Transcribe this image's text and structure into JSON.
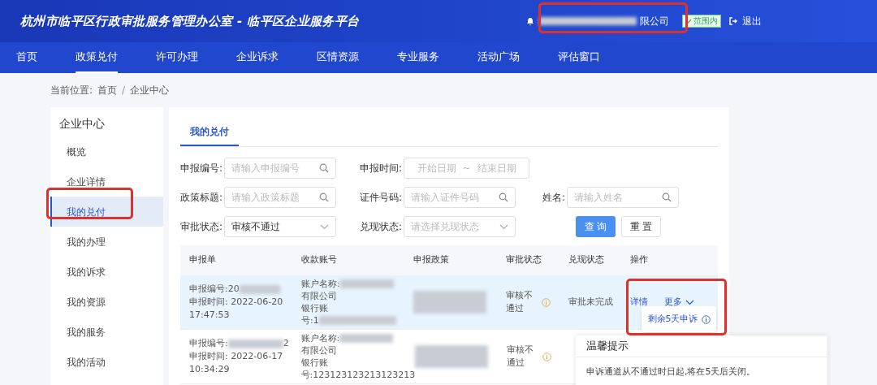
{
  "header": {
    "title": "杭州市临平区行政审批服务管理办公室 - 临平区企业服务平台",
    "company": "限公司",
    "scope_badge": "范围内",
    "logout": "退出"
  },
  "nav": [
    {
      "label": "首页",
      "selected": false
    },
    {
      "label": "政策兑付",
      "selected": true
    },
    {
      "label": "许可办理",
      "selected": false
    },
    {
      "label": "企业诉求",
      "selected": false
    },
    {
      "label": "区情资源",
      "selected": false
    },
    {
      "label": "专业服务",
      "selected": false
    },
    {
      "label": "活动广场",
      "selected": false
    },
    {
      "label": "评估窗口",
      "selected": false
    }
  ],
  "breadcrumb": {
    "label": "当前位置:",
    "separator": "/",
    "items": [
      "首页",
      "企业中心"
    ]
  },
  "sidebar": {
    "title": "企业中心",
    "items": [
      {
        "label": "概览",
        "selected": false
      },
      {
        "label": "企业详情",
        "selected": false
      },
      {
        "label": "我的兑付",
        "selected": true
      },
      {
        "label": "我的办理",
        "selected": false
      },
      {
        "label": "我的诉求",
        "selected": false
      },
      {
        "label": "我的资源",
        "selected": false
      },
      {
        "label": "我的服务",
        "selected": false
      },
      {
        "label": "我的活动",
        "selected": false
      }
    ]
  },
  "tabs": [
    {
      "label": "我的兑付",
      "selected": true
    }
  ],
  "filters": [
    {
      "kind": "search",
      "label": "申报编号:",
      "placeholder": "请输入申报编号"
    },
    {
      "kind": "daterange",
      "label": "申报时间:",
      "placeholder": "开始日期",
      "placeholder_end": "结束日期",
      "separator": "~"
    },
    {
      "kind": "empty"
    },
    {
      "kind": "search",
      "label": "政策标题:",
      "placeholder": "请输入政策标题"
    },
    {
      "kind": "search",
      "label": "证件号码:",
      "placeholder": "请输入证件号码"
    },
    {
      "kind": "search",
      "label": "姓名:",
      "placeholder": "请输入姓名"
    },
    {
      "kind": "select",
      "label": "审批状态:",
      "value": "审核不通过"
    },
    {
      "kind": "select",
      "label": "兑现状态:",
      "placeholder": "请选择兑现状态"
    },
    {
      "kind": "buttons"
    }
  ],
  "buttons": {
    "query": "查 询",
    "reset": "重 置"
  },
  "table": {
    "columns": [
      "申报单",
      "收款账号",
      "申报政策",
      "审批状态",
      "兑现状态",
      "操作"
    ],
    "rows": [
      {
        "selected": true,
        "id_prefix": "申报编号:20",
        "time": "申报时间: 2022-06-20",
        "time_cont": "17:47:53",
        "account": [
          "账户名称:",
          "有限公司",
          "银行账",
          "号:1"
        ],
        "approval": "审核不通过",
        "cash": "审批未完成",
        "actions": {
          "detail": "详情",
          "more": "更多"
        }
      },
      {
        "selected": false,
        "id_prefix": "申报编号:",
        "id_suffix": "2",
        "time": "申报时间: 2022-06-17",
        "time_cont": "10:34:29",
        "account": [
          "账户名称:",
          "有限公司",
          "银行账",
          "号:123123123213123213"
        ],
        "approval": "审核不通过"
      }
    ]
  },
  "dropdown": {
    "item": "剩余5天申诉"
  },
  "tooltip": {
    "title": "温馨提示",
    "text": "申诉通道从不通过时日起,将在5天后关闭。"
  }
}
